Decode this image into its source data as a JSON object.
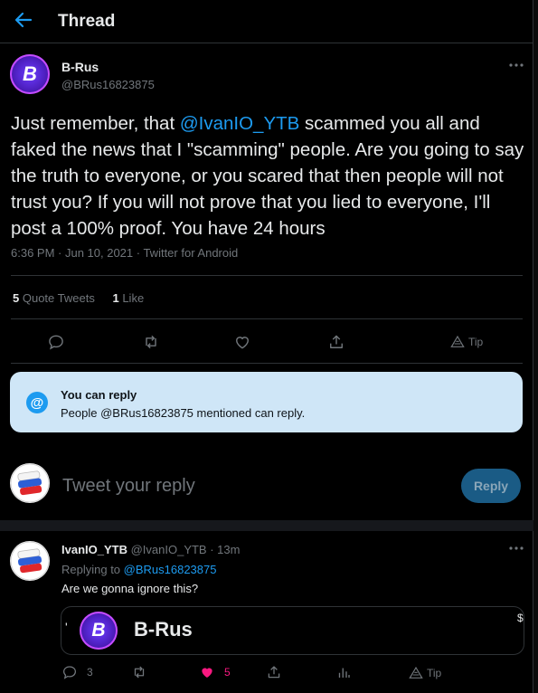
{
  "header": {
    "title": "Thread"
  },
  "tweet": {
    "name": "B-Rus",
    "handle": "@BRus16823875",
    "text_before": "Just remember, that ",
    "mention": "@IvanIO_YTB",
    "text_after": " scammed you all and faked the news that I \"scamming\" people. Are you going to say the truth to everyone, or you scared that then people will not trust you? If you will not prove that you lied to everyone, I'll post a 100% proof. You have 24 hours",
    "meta": "6:36 PM · Jun 10, 2021 · Twitter for Android",
    "quote_count": "5",
    "quote_label": "Quote Tweets",
    "like_count": "1",
    "like_label": "Like",
    "tip_label": "Tip"
  },
  "reply_notice": {
    "title": "You can reply",
    "text": "People @BRus16823875 mentioned can reply."
  },
  "compose": {
    "placeholder": "Tweet your reply",
    "reply_button": "Reply"
  },
  "reply": {
    "name": "IvanIO_YTB",
    "handle": "@IvanIO_YTB",
    "time": "· 13m",
    "replying_prefix": "Replying to ",
    "replying_to": "@BRus16823875",
    "text": "Are we gonna ignore this?",
    "embed_title": "B-Rus",
    "embed_left_mark": "'",
    "embed_right_mark": "$",
    "reply_count": "3",
    "like_count": "5",
    "tip_label": "Tip"
  },
  "colors": {
    "accent": "#1d9bf0",
    "like": "#f91880",
    "notice_bg": "#cfe6f7"
  },
  "icons": [
    "back-arrow-icon",
    "more-icon",
    "reply-icon",
    "retweet-icon",
    "like-icon",
    "share-icon",
    "tip-icon",
    "at-icon",
    "stats-icon"
  ]
}
